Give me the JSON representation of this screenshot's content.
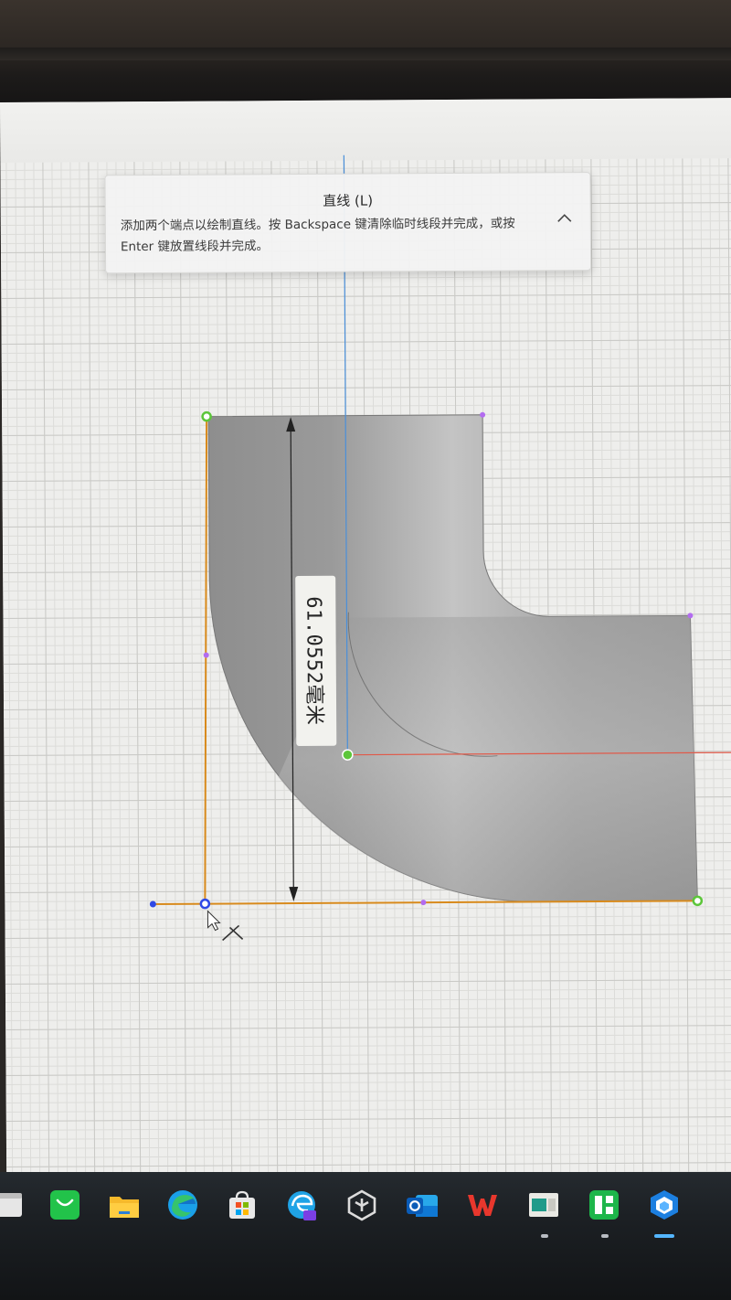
{
  "tooltip": {
    "title": "直线 (L)",
    "description": "添加两个端点以绘制直线。按 Backspace 键清除临时线段并完成，或按 Enter 键放置线段并完成。"
  },
  "dimension": {
    "value": "61.0552",
    "unit": "毫米",
    "text": "61.0552毫米"
  },
  "colors": {
    "sketch_line": "#d88a1c",
    "vertical_guide": "#4a8fd9",
    "horizontal_guide": "#e05a4a",
    "point_green": "#5cc63a",
    "point_purple": "#b36cf0",
    "point_blue": "#2f49e6"
  },
  "taskbar": {
    "icons": [
      {
        "name": "file-window-icon"
      },
      {
        "name": "wechat-icon"
      },
      {
        "name": "file-explorer-icon"
      },
      {
        "name": "edge-icon"
      },
      {
        "name": "microsoft-store-icon"
      },
      {
        "name": "edge-ai-icon"
      },
      {
        "name": "unity-icon"
      },
      {
        "name": "outlook-icon"
      },
      {
        "name": "wps-office-icon"
      },
      {
        "name": "app-window-icon"
      },
      {
        "name": "green-grid-app-icon"
      },
      {
        "name": "cad-app-icon"
      }
    ]
  }
}
